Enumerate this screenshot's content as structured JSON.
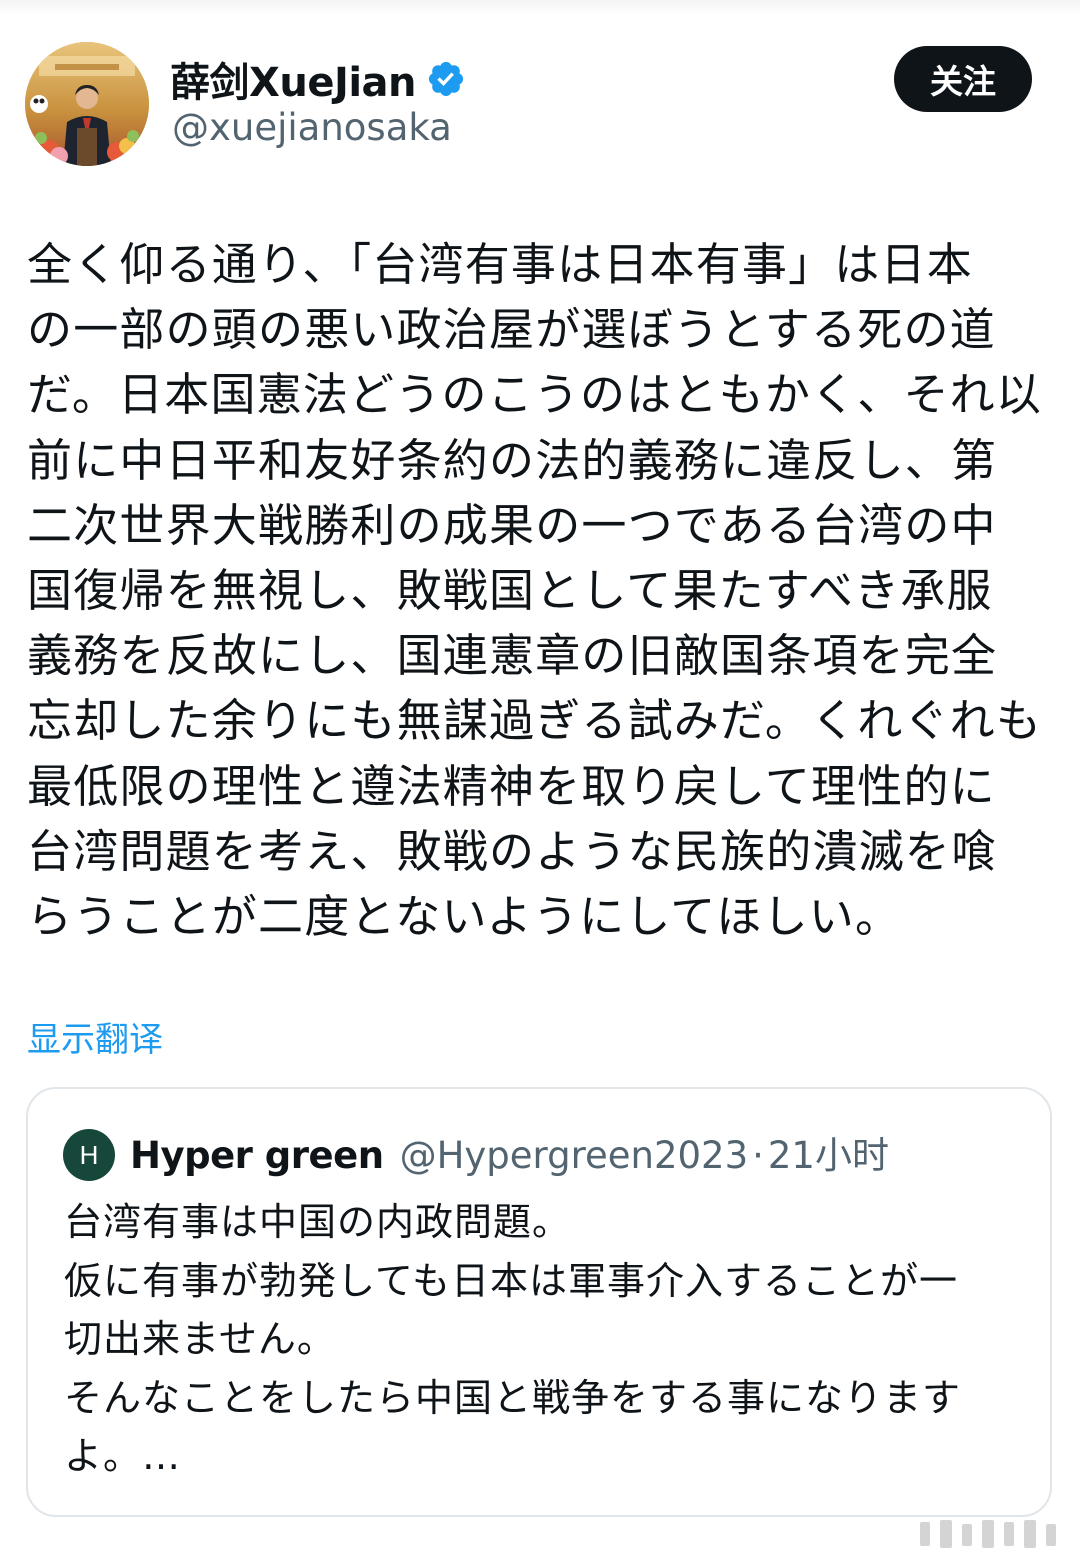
{
  "author": {
    "display_name": "薛剑XueJian",
    "handle": "@xuejianosaka",
    "verified_icon": "verified-badge-icon",
    "avatar_icon": "profile-photo"
  },
  "follow_button": {
    "label": "关注"
  },
  "tweet": {
    "lines": [
      "全く仰る通り、「台湾有事は日本有事」は日本",
      "の一部の頭の悪い政治屋が選ぼうとする死の道",
      "だ。日本国憲法どうのこうのはともかく、それ以",
      "前に中日平和友好条約の法的義務に違反し、第",
      "二次世界大戦勝利の成果の一つである台湾の中",
      "国復帰を無視し、敗戦国として果たすべき承服",
      "義務を反故にし、国連憲章の旧敵国条項を完全",
      "忘却した余りにも無謀過ぎる試みだ。くれぐれも",
      "最低限の理性と遵法精神を取り戻して理性的に",
      "台湾問題を考え、敗戦のような民族的潰滅を喰",
      "らうことが二度とないようにしてほしい。"
    ]
  },
  "translate_link": {
    "label": "显示翻译"
  },
  "quoted": {
    "avatar_letter": "H",
    "name": "Hyper green",
    "handle": "@Hypergreen2023",
    "separator": "·",
    "time": "21小时",
    "lines": [
      "台湾有事は中国の内政問題。",
      "仮に有事が勃発しても日本は軍事介入することが一",
      "切出来ません。",
      "そんなことをしたら中国と戦争をする事になります",
      "よ。…"
    ]
  },
  "colors": {
    "link": "#1d9bf0",
    "text": "#0f1419",
    "secondary": "#536471",
    "button_bg": "#0f1419",
    "verified": "#1d9bf0",
    "quote_avatar_bg": "#17473a"
  }
}
